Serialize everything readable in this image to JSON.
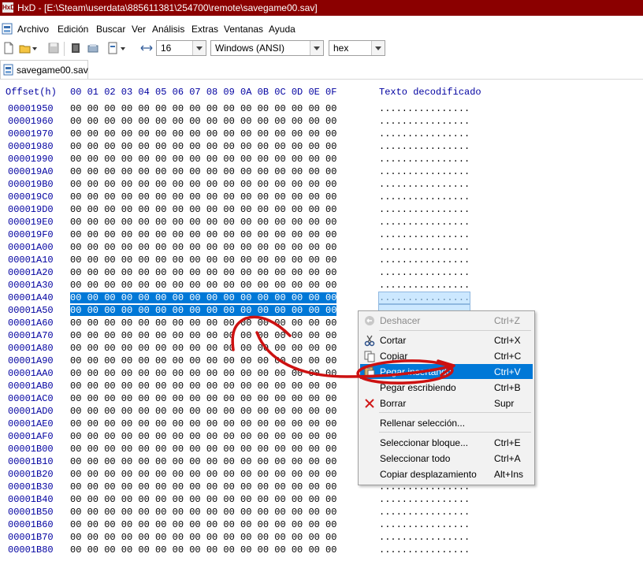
{
  "window": {
    "title": "HxD - [E:\\Steam\\userdata\\885611381\\254700\\remote\\savegame00.sav]",
    "app_icon_text": "HxD"
  },
  "menu": [
    "Archivo",
    "Edición",
    "Buscar",
    "Ver",
    "Análisis",
    "Extras",
    "Ventanas",
    "Ayuda"
  ],
  "toolbar": {
    "bytes_per_row": "16",
    "charset": "Windows (ANSI)",
    "offset_base": "hex"
  },
  "tab": {
    "label": "savegame00.sav"
  },
  "hex": {
    "offset_header": "Offset(h)",
    "column_header": "00 01 02 03 04 05 06 07 08 09 0A 0B 0C 0D 0E 0F",
    "text_header": "Texto decodificado",
    "row_bytes": "00 00 00 00 00 00 00 00 00 00 00 00 00 00 00 00",
    "row_text": "................",
    "offsets": [
      "00001950",
      "00001960",
      "00001970",
      "00001980",
      "00001990",
      "000019A0",
      "000019B0",
      "000019C0",
      "000019D0",
      "000019E0",
      "000019F0",
      "00001A00",
      "00001A10",
      "00001A20",
      "00001A30",
      "00001A40",
      "00001A50",
      "00001A60",
      "00001A70",
      "00001A80",
      "00001A90",
      "00001AA0",
      "00001AB0",
      "00001AC0",
      "00001AD0",
      "00001AE0",
      "00001AF0",
      "00001B00",
      "00001B10",
      "00001B20",
      "00001B30",
      "00001B40",
      "00001B50",
      "00001B60",
      "00001B70",
      "00001B80"
    ],
    "selected_offsets": [
      "00001A40",
      "00001A50"
    ]
  },
  "context_menu": {
    "items": [
      {
        "label": "Deshacer",
        "shortcut": "Ctrl+Z",
        "enabled": false,
        "icon": "undo-icon"
      },
      {
        "label": "Cortar",
        "shortcut": "Ctrl+X",
        "enabled": true,
        "icon": "scissors-icon"
      },
      {
        "label": "Copiar",
        "shortcut": "Ctrl+C",
        "enabled": true,
        "icon": "copy-icon"
      },
      {
        "label": "Pegar insertando",
        "shortcut": "Ctrl+V",
        "enabled": true,
        "icon": "paste-icon",
        "highlighted": true
      },
      {
        "label": "Pegar escribiendo",
        "shortcut": "Ctrl+B",
        "enabled": true
      },
      {
        "label": "Borrar",
        "shortcut": "Supr",
        "enabled": true,
        "icon": "delete-x-icon"
      },
      {
        "label": "Rellenar selección...",
        "shortcut": "",
        "enabled": true
      },
      {
        "label": "Seleccionar bloque...",
        "shortcut": "Ctrl+E",
        "enabled": true
      },
      {
        "label": "Seleccionar todo",
        "shortcut": "Ctrl+A",
        "enabled": true
      },
      {
        "label": "Copiar desplazamiento",
        "shortcut": "Alt+Ins",
        "enabled": true
      }
    ]
  },
  "colors": {
    "titlebar": "#8b0000",
    "selection": "#0078d7",
    "offset_text": "#0000a0",
    "annotation": "#cc1111"
  }
}
